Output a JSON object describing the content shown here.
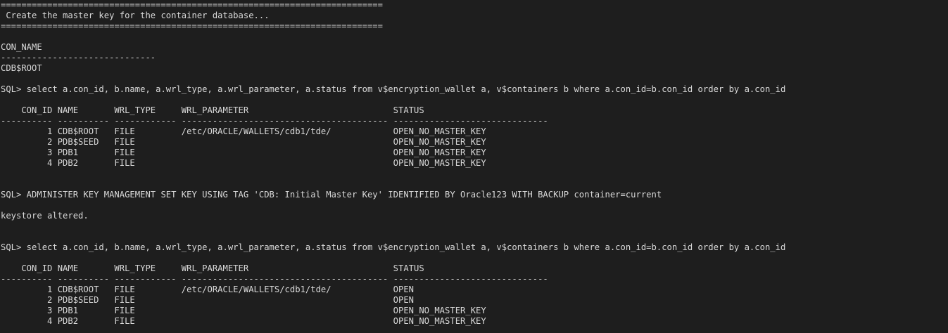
{
  "terminal": {
    "lines": [
      "==========================================================================",
      " Create the master key for the container database...",
      "==========================================================================",
      "",
      "CON_NAME",
      "------------------------------",
      "CDB$ROOT",
      "",
      "SQL> select a.con_id, b.name, a.wrl_type, a.wrl_parameter, a.status from v$encryption_wallet a, v$containers b where a.con_id=b.con_id order by a.con_id",
      "",
      "    CON_ID NAME       WRL_TYPE     WRL_PARAMETER                            STATUS",
      "---------- ---------- ------------ ---------------------------------------- ------------------------------",
      "         1 CDB$ROOT   FILE         /etc/ORACLE/WALLETS/cdb1/tde/            OPEN_NO_MASTER_KEY",
      "         2 PDB$SEED   FILE                                                  OPEN_NO_MASTER_KEY",
      "         3 PDB1       FILE                                                  OPEN_NO_MASTER_KEY",
      "         4 PDB2       FILE                                                  OPEN_NO_MASTER_KEY",
      "",
      "",
      "SQL> ADMINISTER KEY MANAGEMENT SET KEY USING TAG 'CDB: Initial Master Key' IDENTIFIED BY Oracle123 WITH BACKUP container=current",
      "",
      "keystore altered.",
      "",
      "",
      "SQL> select a.con_id, b.name, a.wrl_type, a.wrl_parameter, a.status from v$encryption_wallet a, v$containers b where a.con_id=b.con_id order by a.con_id",
      "",
      "    CON_ID NAME       WRL_TYPE     WRL_PARAMETER                            STATUS",
      "---------- ---------- ------------ ---------------------------------------- ------------------------------",
      "         1 CDB$ROOT   FILE         /etc/ORACLE/WALLETS/cdb1/tde/            OPEN",
      "         2 PDB$SEED   FILE                                                  OPEN",
      "         3 PDB1       FILE                                                  OPEN_NO_MASTER_KEY",
      "         4 PDB2       FILE                                                  OPEN_NO_MASTER_KEY"
    ]
  }
}
